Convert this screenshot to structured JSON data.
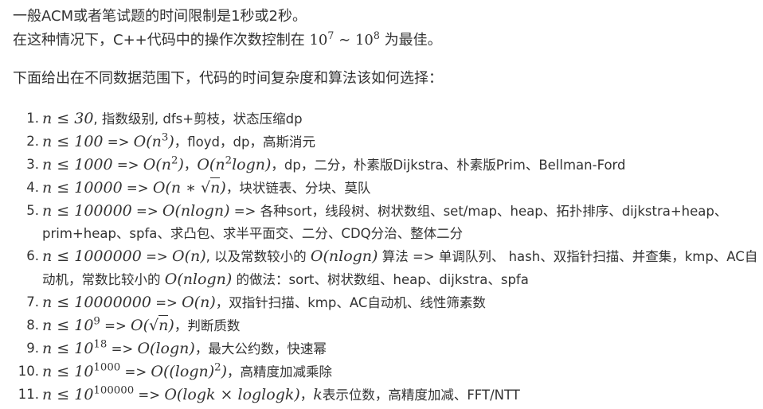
{
  "intro": {
    "line1": "一般ACM或者笔试题的时间限制是1秒或2秒。",
    "line2_prefix": "在这种情况下，C++代码中的操作次数控制在",
    "line2_math_a": "10",
    "line2_exp_a": "7",
    "line2_tilde": "∼",
    "line2_math_b": "10",
    "line2_exp_b": "8",
    "line2_suffix": "为最佳。"
  },
  "subheading": "下面给出在不同数据范围下，代码的时间复杂度和算法该如何选择：",
  "rules": [
    {
      "num": "1.",
      "cond": "n ≤ 30",
      "text": ", 指数级别, dfs+剪枝，状态压缩dp"
    },
    {
      "num": "2.",
      "cond": "n ≤ 100",
      "arrow": " => ",
      "complexity_base": "O(n",
      "complexity_exp": "3",
      "complexity_tail": ")",
      "text": "，floyd，dp，高斯消元"
    },
    {
      "num": "3.",
      "cond": "n ≤ 1000",
      "arrow": " => ",
      "complexity_a_base": "O(n",
      "complexity_a_exp": "2",
      "complexity_a_tail": ")",
      "sep": "，",
      "complexity_b_base": "O(n",
      "complexity_b_exp": "2",
      "complexity_b_tail": "logn)",
      "text": "，dp，二分，朴素版Dijkstra、朴素版Prim、Bellman-Ford"
    },
    {
      "num": "4.",
      "cond": "n ≤ 10000",
      "arrow": " => ",
      "complexity_a": "O(n ∗ √",
      "complexity_b": "n",
      "complexity_c": ")",
      "text": "，块状链表、分块、莫队"
    },
    {
      "num": "5.",
      "cond": "n ≤ 100000",
      "arrow": " => ",
      "complexity": "O(nlogn)",
      "text": " => 各种sort，线段树、树状数组、set/map、heap、拓扑排序、dijkstra+heap、",
      "cont": "prim+heap、spfa、求凸包、求半平面交、二分、CDQ分治、整体二分"
    },
    {
      "num": "6.",
      "cond": "n ≤ 1000000",
      "arrow": " => ",
      "complexity": "O(n)",
      "text_a": ", 以及常数较小的 ",
      "complexity_2": "O(nlogn)",
      "text_b": " 算法 => 单调队列、 hash、双指针扫描、并查集，kmp、AC自",
      "cont_a": "动机，常数比较小的 ",
      "cont_complexity": "O(nlogn)",
      "cont_b": " 的做法：sort、树状数组、heap、dijkstra、spfa"
    },
    {
      "num": "7.",
      "cond": "n ≤ 10000000",
      "arrow": " => ",
      "complexity": "O(n)",
      "text": "，双指针扫描、kmp、AC自动机、线性筛素数"
    },
    {
      "num": "8.",
      "cond_base": "n ≤ 10",
      "cond_exp": "9",
      "arrow": " => ",
      "complexity_a": "O(√",
      "complexity_b": "n",
      "complexity_c": ")",
      "text": "，判断质数"
    },
    {
      "num": "9.",
      "cond_base": "n ≤ 10",
      "cond_exp": "18",
      "arrow": " => ",
      "complexity": "O(logn)",
      "text": "，最大公约数，快速幂"
    },
    {
      "num": "10.",
      "cond_base": "n ≤ 10",
      "cond_exp": "1000",
      "arrow": " => ",
      "complexity_base": "O((logn)",
      "complexity_exp": "2",
      "complexity_tail": ")",
      "text": "，高精度加减乘除"
    },
    {
      "num": "11.",
      "cond_base": "n ≤ 10",
      "cond_exp": "100000",
      "arrow": " => ",
      "complexity": "O(logk × loglogk)",
      "sep": "，",
      "var": "k",
      "text": "表示位数，高精度加减、FFT/NTT"
    }
  ]
}
